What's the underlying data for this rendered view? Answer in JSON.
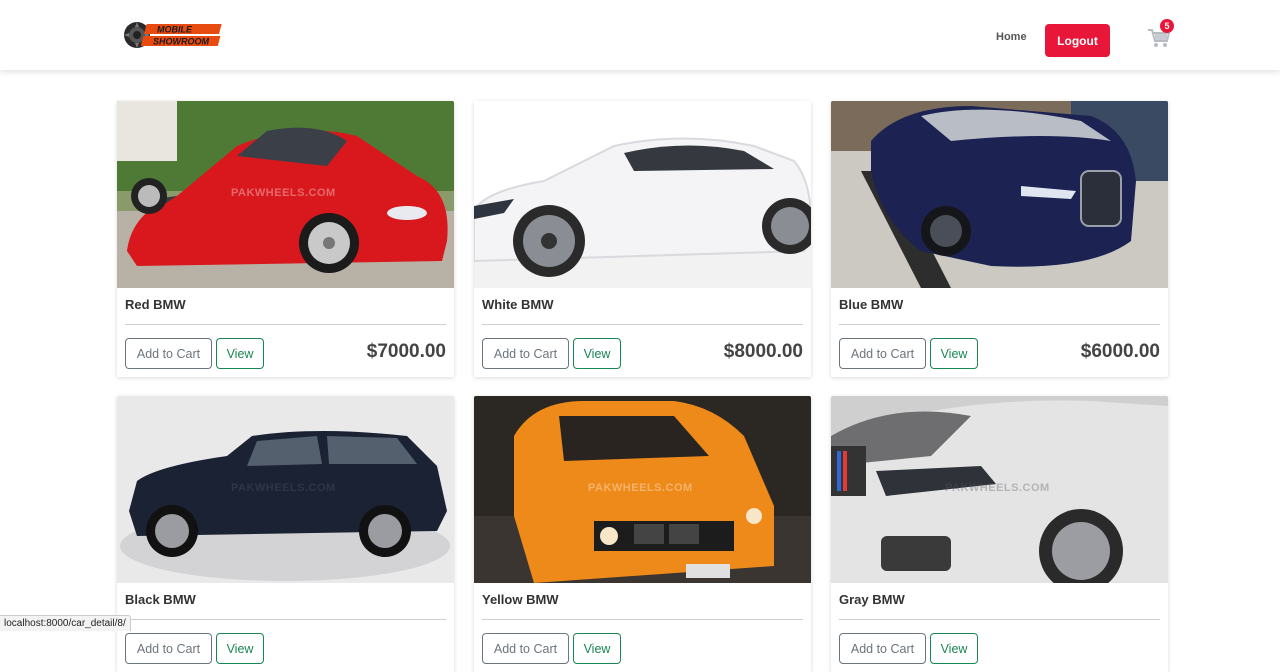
{
  "navbar": {
    "logo_line1": "MOBILE",
    "logo_line2": "SHOWROOM",
    "home_label": "Home",
    "logout_label": "Logout",
    "cart_count": "5",
    "accent": "#e8173a"
  },
  "cards": [
    {
      "title": "Red BMW",
      "price": "$7000.00",
      "add_label": "Add to Cart",
      "view_label": "View",
      "car_color": "#d8181c"
    },
    {
      "title": "White BMW",
      "price": "$8000.00",
      "add_label": "Add to Cart",
      "view_label": "View",
      "car_color": "#f2f2f2"
    },
    {
      "title": "Blue BMW",
      "price": "$6000.00",
      "add_label": "Add to Cart",
      "view_label": "View",
      "car_color": "#1c2251"
    },
    {
      "title": "Black BMW",
      "price": "",
      "add_label": "Add to Cart",
      "view_label": "View",
      "car_color": "#1a2233"
    },
    {
      "title": "Yellow BMW",
      "price": "",
      "add_label": "Add to Cart",
      "view_label": "View",
      "car_color": "#ee8a1a"
    },
    {
      "title": "Gray BMW",
      "price": "",
      "add_label": "Add to Cart",
      "view_label": "View",
      "car_color": "#d8d8d8"
    }
  ],
  "watermark": "PAKWHEELS.COM",
  "status_bar": "localhost:8000/car_detail/8/"
}
